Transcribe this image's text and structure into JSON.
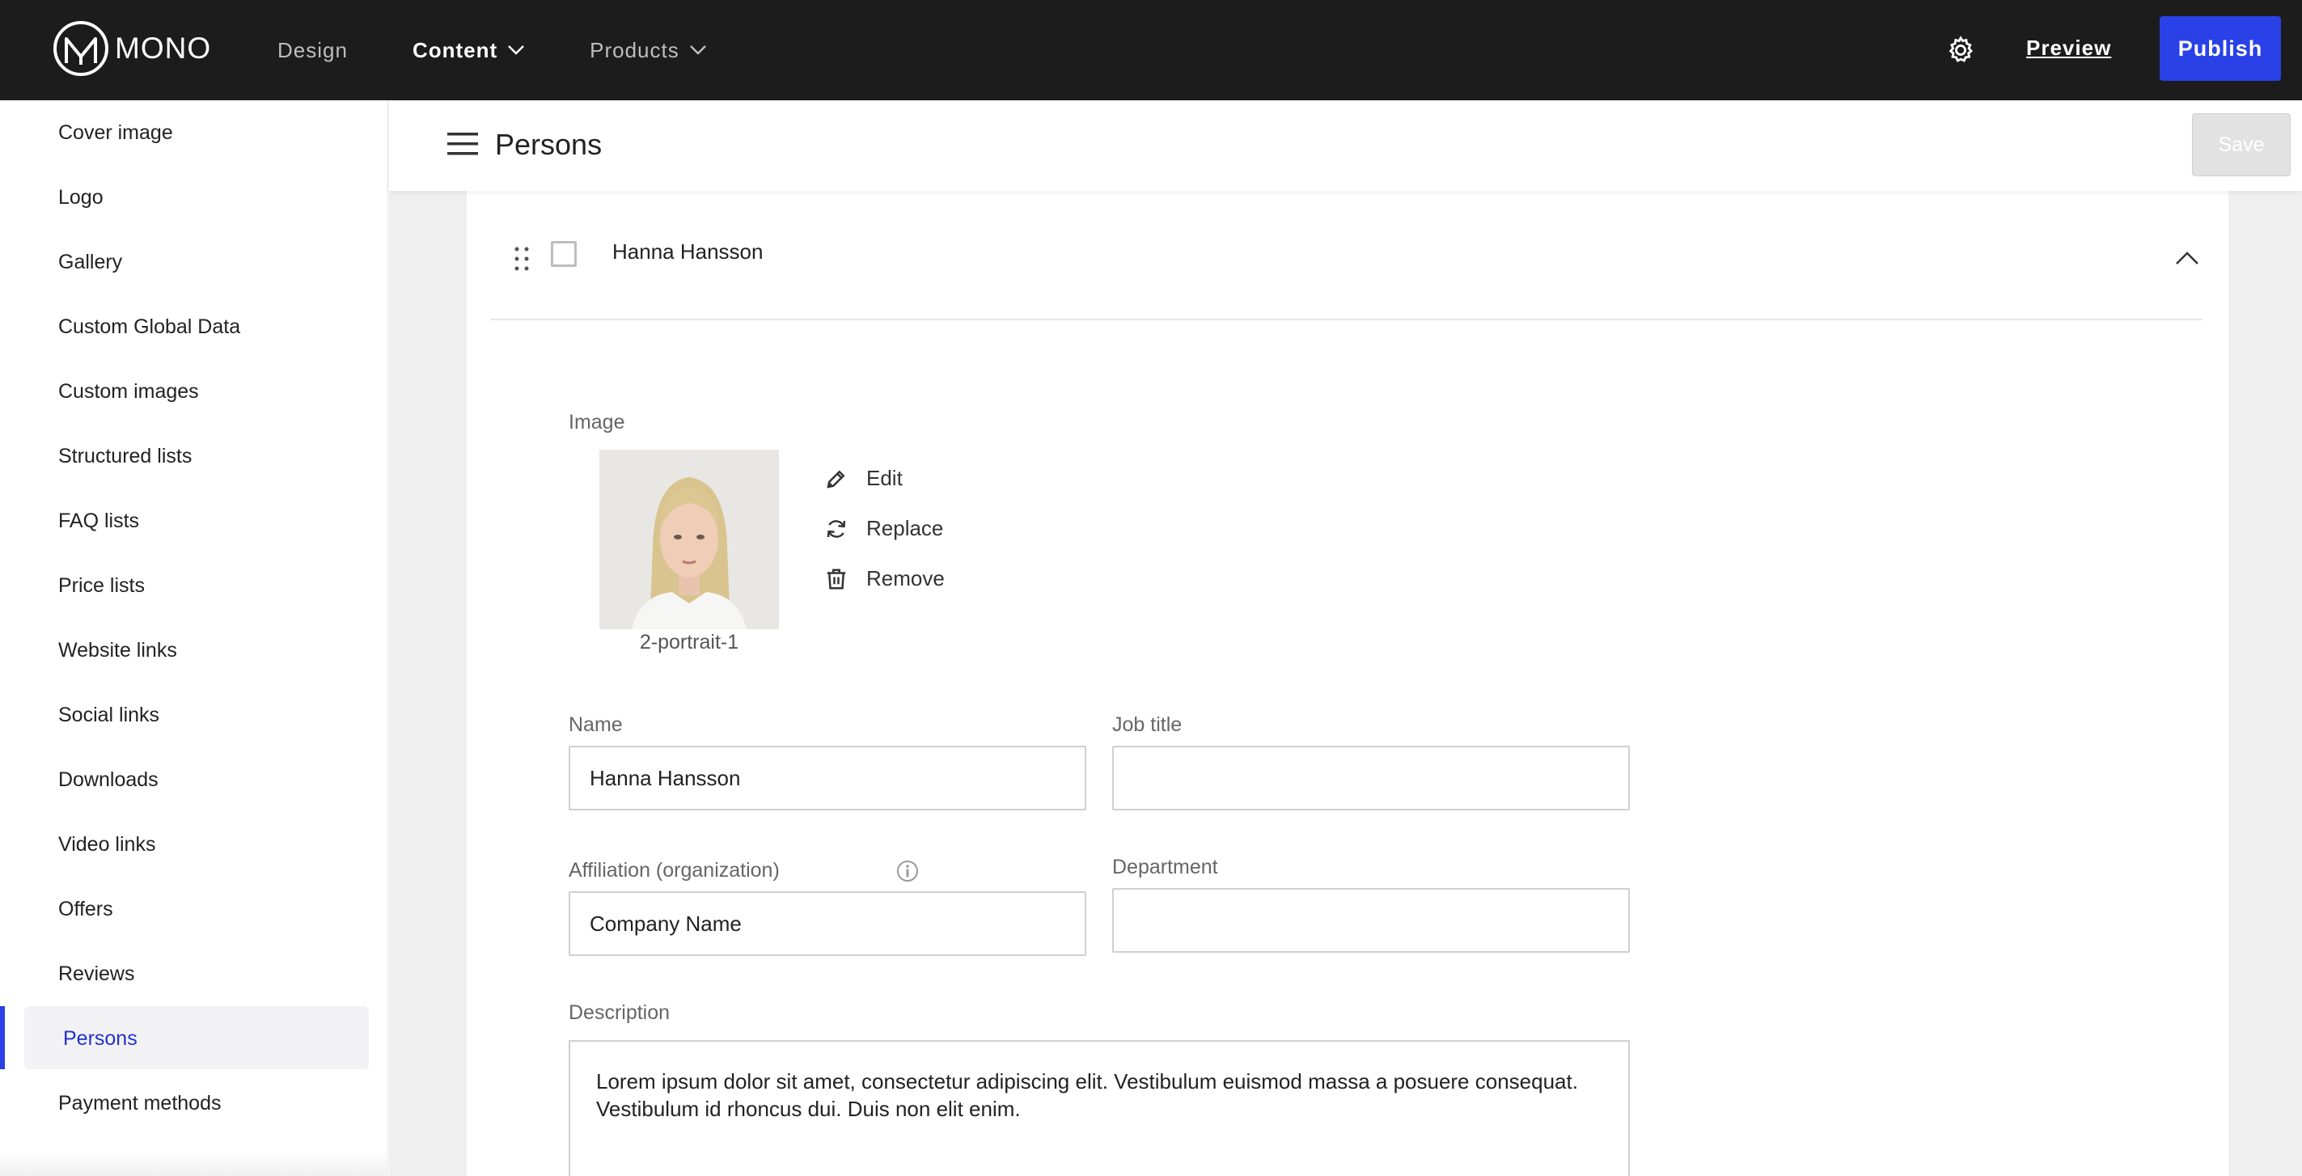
{
  "topbar": {
    "logo_text": "MONO",
    "nav": [
      {
        "label": "Design"
      },
      {
        "label": "Content"
      },
      {
        "label": "Products"
      }
    ],
    "preview_label": "Preview",
    "publish_label": "Publish"
  },
  "sidebar": {
    "items": [
      {
        "label": "Cover image"
      },
      {
        "label": "Logo"
      },
      {
        "label": "Gallery"
      },
      {
        "label": "Custom Global Data"
      },
      {
        "label": "Custom images"
      },
      {
        "label": "Structured lists"
      },
      {
        "label": "FAQ lists"
      },
      {
        "label": "Price lists"
      },
      {
        "label": "Website links"
      },
      {
        "label": "Social links"
      },
      {
        "label": "Downloads"
      },
      {
        "label": "Video links"
      },
      {
        "label": "Offers"
      },
      {
        "label": "Reviews"
      },
      {
        "label": "Persons"
      },
      {
        "label": "Payment methods"
      }
    ],
    "active": "Persons"
  },
  "main": {
    "title": "Persons",
    "save_label": "Save",
    "row": {
      "name": "Hanna Hansson"
    },
    "image": {
      "label": "Image",
      "caption": "2-portrait-1",
      "actions": {
        "edit": "Edit",
        "replace": "Replace",
        "remove": "Remove"
      }
    },
    "form": {
      "name_label": "Name",
      "name_value": "Hanna Hansson",
      "job_title_label": "Job title",
      "job_title_value": "",
      "affiliation_label": "Affiliation (organization)",
      "affiliation_value": "Company Name",
      "department_label": "Department",
      "department_value": "",
      "description_label": "Description",
      "description_value": "Lorem ipsum dolor sit amet, consectetur adipiscing elit. Vestibulum euismod massa a posuere consequat. Vestibulum id rhoncus dui. Duis non elit enim."
    }
  },
  "colors": {
    "topbar": "#1c1c1c",
    "accent": "#2941e6",
    "active_text": "#2233cc"
  }
}
